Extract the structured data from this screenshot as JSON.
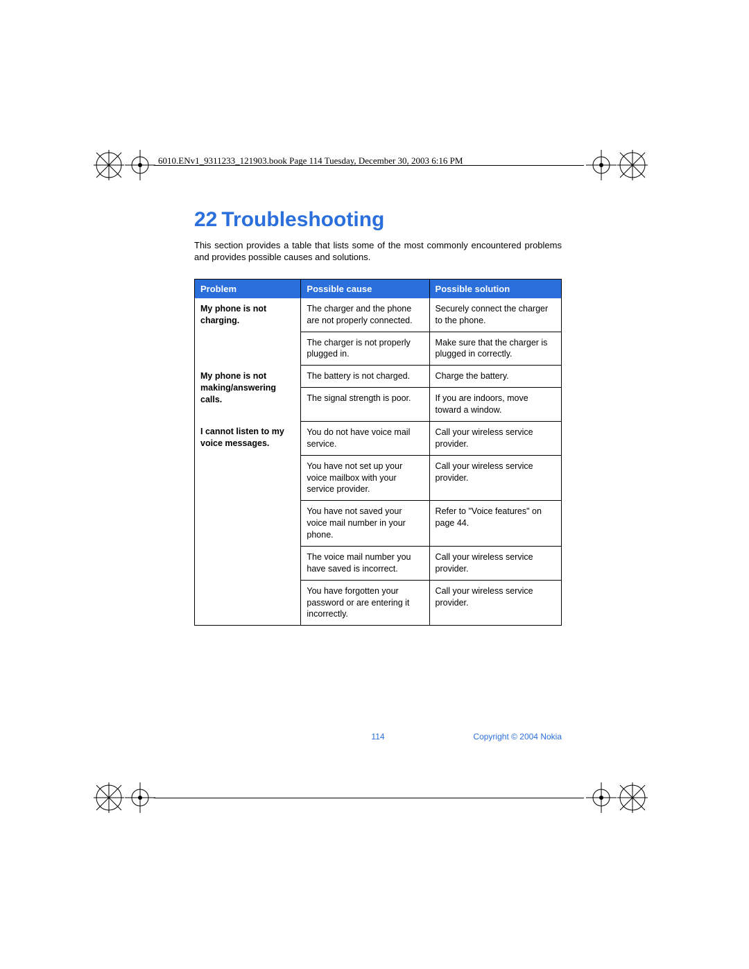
{
  "header_text": "6010.ENv1_9311233_121903.book  Page 114  Tuesday, December 30, 2003  6:16 PM",
  "chapter": {
    "number": "22",
    "title": "Troubleshooting"
  },
  "intro": "This section provides a table that lists some of the most commonly encountered problems and provides possible causes and solutions.",
  "table": {
    "headers": {
      "problem": "Problem",
      "cause": "Possible cause",
      "solution": "Possible solution"
    },
    "rows": [
      {
        "problem": "My phone is not charging.",
        "cause": "The charger and the phone are not properly connected.",
        "solution": "Securely connect the charger to the phone."
      },
      {
        "problem": "",
        "cause": "The charger is not properly plugged in.",
        "solution": "Make sure that the charger is plugged in correctly."
      },
      {
        "problem": "My phone is not making/answering calls.",
        "cause": "The battery is not charged.",
        "solution": "Charge the battery."
      },
      {
        "problem": "",
        "cause": "The signal strength is poor.",
        "solution": "If you are indoors, move toward a window."
      },
      {
        "problem": "I cannot listen to my voice messages.",
        "cause": "You do not have voice mail service.",
        "solution": "Call your wireless service provider."
      },
      {
        "problem": "",
        "cause": "You have not set up your voice mailbox with your service provider.",
        "solution": "Call your wireless service provider."
      },
      {
        "problem": "",
        "cause": "You have not saved your voice mail number in your phone.",
        "solution": "Refer to \"Voice features\" on page 44."
      },
      {
        "problem": "",
        "cause": "The voice mail number you have saved is incorrect.",
        "solution": "Call your wireless service provider."
      },
      {
        "problem": "",
        "cause": "You have forgotten your password or are entering it incorrectly.",
        "solution": "Call your wireless service provider."
      }
    ]
  },
  "footer": {
    "page": "114",
    "copyright": "Copyright © 2004 Nokia"
  }
}
